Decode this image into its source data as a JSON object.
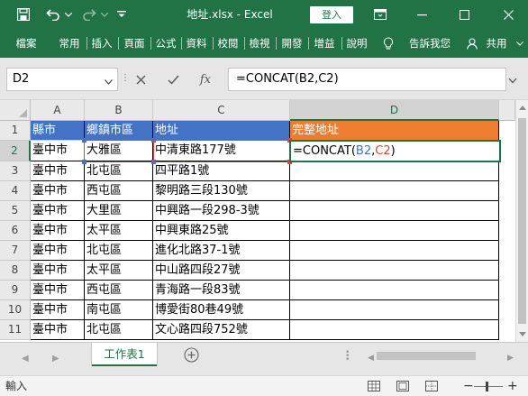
{
  "window": {
    "title": "地址.xlsx - Excel",
    "login_label": "登入",
    "colors": {
      "excel_green": "#217346",
      "header_blue": "#4472c4",
      "header_orange": "#ed7d31",
      "ref_red": "#e0443a"
    }
  },
  "ribbon": {
    "tabs": [
      "檔案",
      "常用",
      "插入",
      "頁面",
      "公式",
      "資料",
      "校閱",
      "檢視",
      "開發",
      "增益",
      "說明"
    ],
    "tell_me": "告訴我您",
    "share": "共用"
  },
  "formula_bar": {
    "name_box": "D2",
    "formula": "=CONCAT(B2,C2)"
  },
  "grid": {
    "columns": [
      "A",
      "B",
      "C",
      "D"
    ],
    "row_numbers": [
      "1",
      "2",
      "3",
      "4",
      "5",
      "6",
      "7",
      "8",
      "9",
      "10",
      "11"
    ],
    "headers": [
      "縣市",
      "鄉鎮市區",
      "地址",
      "完整地址"
    ],
    "rows": [
      [
        "臺中市",
        "大雅區",
        "中清東路177號"
      ],
      [
        "臺中市",
        "北屯區",
        "四平路1號"
      ],
      [
        "臺中市",
        "西屯區",
        "黎明路三段130號"
      ],
      [
        "臺中市",
        "大里區",
        "中興路一段298-3號"
      ],
      [
        "臺中市",
        "太平區",
        "中興東路25號"
      ],
      [
        "臺中市",
        "北屯區",
        "進化北路37-1號"
      ],
      [
        "臺中市",
        "太平區",
        "中山路四段27號"
      ],
      [
        "臺中市",
        "西屯區",
        "青海路一段83號"
      ],
      [
        "臺中市",
        "南屯區",
        "博愛街80巷49號"
      ],
      [
        "臺中市",
        "北屯區",
        "文心路四段752號"
      ]
    ],
    "editing": {
      "prefix": "=CONCAT(",
      "ref1": "B2",
      "comma": ",",
      "ref2": "C2",
      "suffix": ")"
    }
  },
  "sheets": {
    "active": "工作表1"
  },
  "status": {
    "mode": "輸入"
  }
}
